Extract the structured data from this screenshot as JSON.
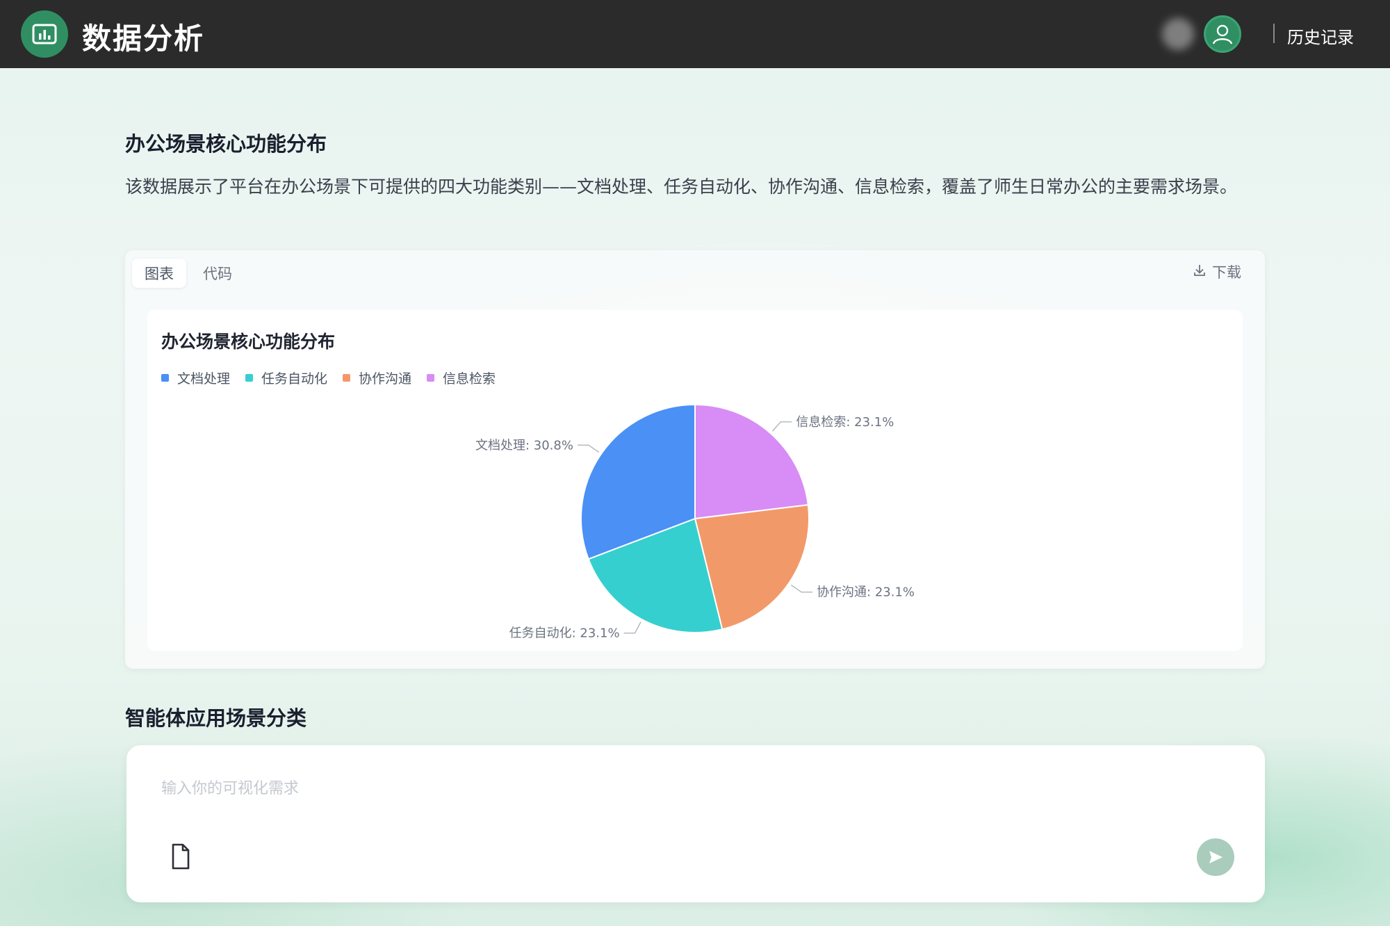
{
  "header": {
    "app_title": "数据分析",
    "history_label": "历史记录",
    "colors": {
      "bar": "#2b2b2b",
      "brand": "#2f8f63"
    },
    "icons": {
      "logo": "bar-chart-icon",
      "avatar": "user-icon"
    }
  },
  "section1": {
    "title": "办公场景核心功能分布",
    "description": "该数据展示了平台在办公场景下可提供的四大功能类别——文档处理、任务自动化、协作沟通、信息检索，覆盖了师生日常办公的主要需求场景。"
  },
  "card": {
    "tabs": [
      {
        "label": "图表",
        "active": true
      },
      {
        "label": "代码",
        "active": false
      }
    ],
    "download_label": "下载",
    "download_icon": "download-icon"
  },
  "chart_data": {
    "type": "pie",
    "title": "办公场景核心功能分布",
    "legend_position": "top-left",
    "categories": [
      "文档处理",
      "任务自动化",
      "协作沟通",
      "信息检索"
    ],
    "values": [
      30.8,
      23.1,
      23.1,
      23.1
    ],
    "unit": "%",
    "colors": [
      "#4a90f5",
      "#36cfd0",
      "#f2996a",
      "#d88cf5"
    ],
    "data_labels": [
      "文档处理: 30.8%",
      "任务自动化: 23.1%",
      "协作沟通: 23.1%",
      "信息检索: 23.1%"
    ]
  },
  "section2": {
    "title": "智能体应用场景分类"
  },
  "composer": {
    "placeholder": "输入你的可视化需求",
    "value": "",
    "attach_icon": "file-icon",
    "send_icon": "send-icon",
    "send_color": "#a9ccbc"
  }
}
